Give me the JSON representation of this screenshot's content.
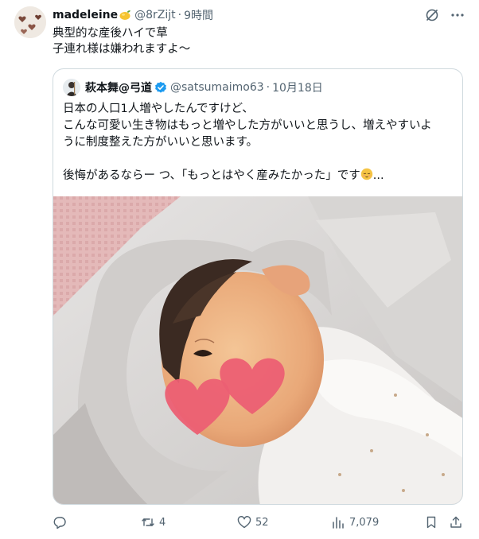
{
  "post": {
    "display_name": "madeleine",
    "handle": "@8rZijt",
    "separator": "·",
    "time": "9時間",
    "text_line1": "典型的な産後ハイで草",
    "text_line2": "子連れ様は嫌われますよ〜"
  },
  "quote": {
    "display_name": "萩本舞@弓道",
    "handle": "@satsumaimo63",
    "separator": "·",
    "date": "10月18日",
    "line1": "日本の人口1人増やしたんですけど、",
    "line2": "こんな可愛い生き物はもっと増やした方がいいと思うし、増えやすいよ",
    "line3": "うに制度整えた方がいいと思います。",
    "line4": "後悔があるならー つ、「もっとはやく産みたかった」です",
    "line4_tail": "..."
  },
  "actions": {
    "reply_count": "",
    "retweet_count": "4",
    "like_count": "52",
    "view_count": "7,079"
  },
  "icons": {
    "reply": "reply-bubble-icon",
    "retweet": "retweet-icon",
    "like": "heart-icon",
    "views": "bar-chart-icon",
    "bookmark": "bookmark-icon",
    "share": "share-icon",
    "grok": "grok-icon",
    "more": "more-dots-icon"
  },
  "colors": {
    "text": "#0f1419",
    "secondary": "#536471",
    "border": "#cfd9de",
    "verified": "#1d9bf0",
    "heart_sticker": "#ec5f73"
  }
}
